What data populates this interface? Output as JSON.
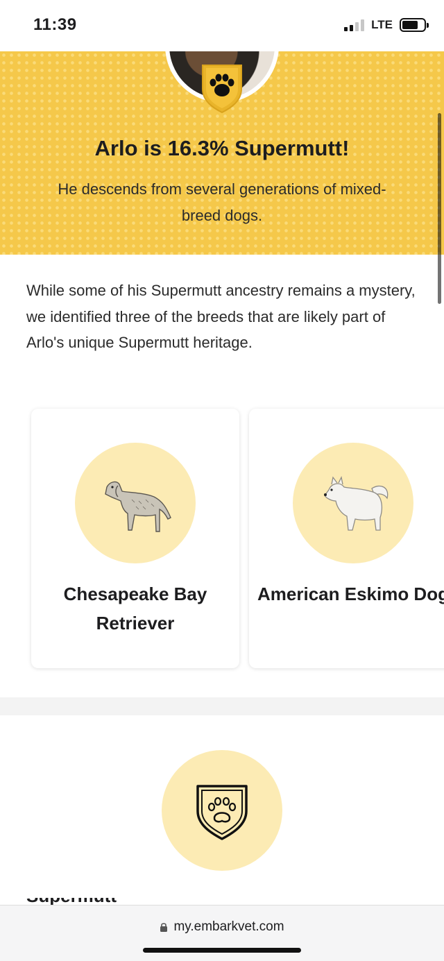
{
  "status_bar": {
    "time": "11:39",
    "network": "LTE",
    "signal_bars_filled": 2,
    "signal_bars_total": 4,
    "icons": [
      "signal-icon",
      "battery-icon"
    ]
  },
  "hero": {
    "title": "Arlo is 16.3% Supermutt!",
    "subtitle": "He descends from several generations of mixed-breed dogs.",
    "badge_icon": "paw-shield-icon",
    "background_color": "#f5c84a"
  },
  "intro": {
    "text": "While some of his Supermutt ancestry remains a mystery, we identified three of the breeds that are likely part of Arlo's unique Supermutt heritage."
  },
  "breeds": [
    {
      "name": "Chesapeake Bay Retriever",
      "icon": "retriever-illustration-icon"
    },
    {
      "name": "American Eskimo Dog",
      "icon": "eskimo-dog-illustration-icon"
    }
  ],
  "section2": {
    "icon": "paw-shield-outline-icon",
    "heading_partial": "Supermutt"
  },
  "browser": {
    "url": "my.embarkvet.com",
    "icons": [
      "lock-icon"
    ]
  },
  "colors": {
    "accent_yellow": "#f5c84a",
    "circle_yellow": "#fcebb4"
  }
}
